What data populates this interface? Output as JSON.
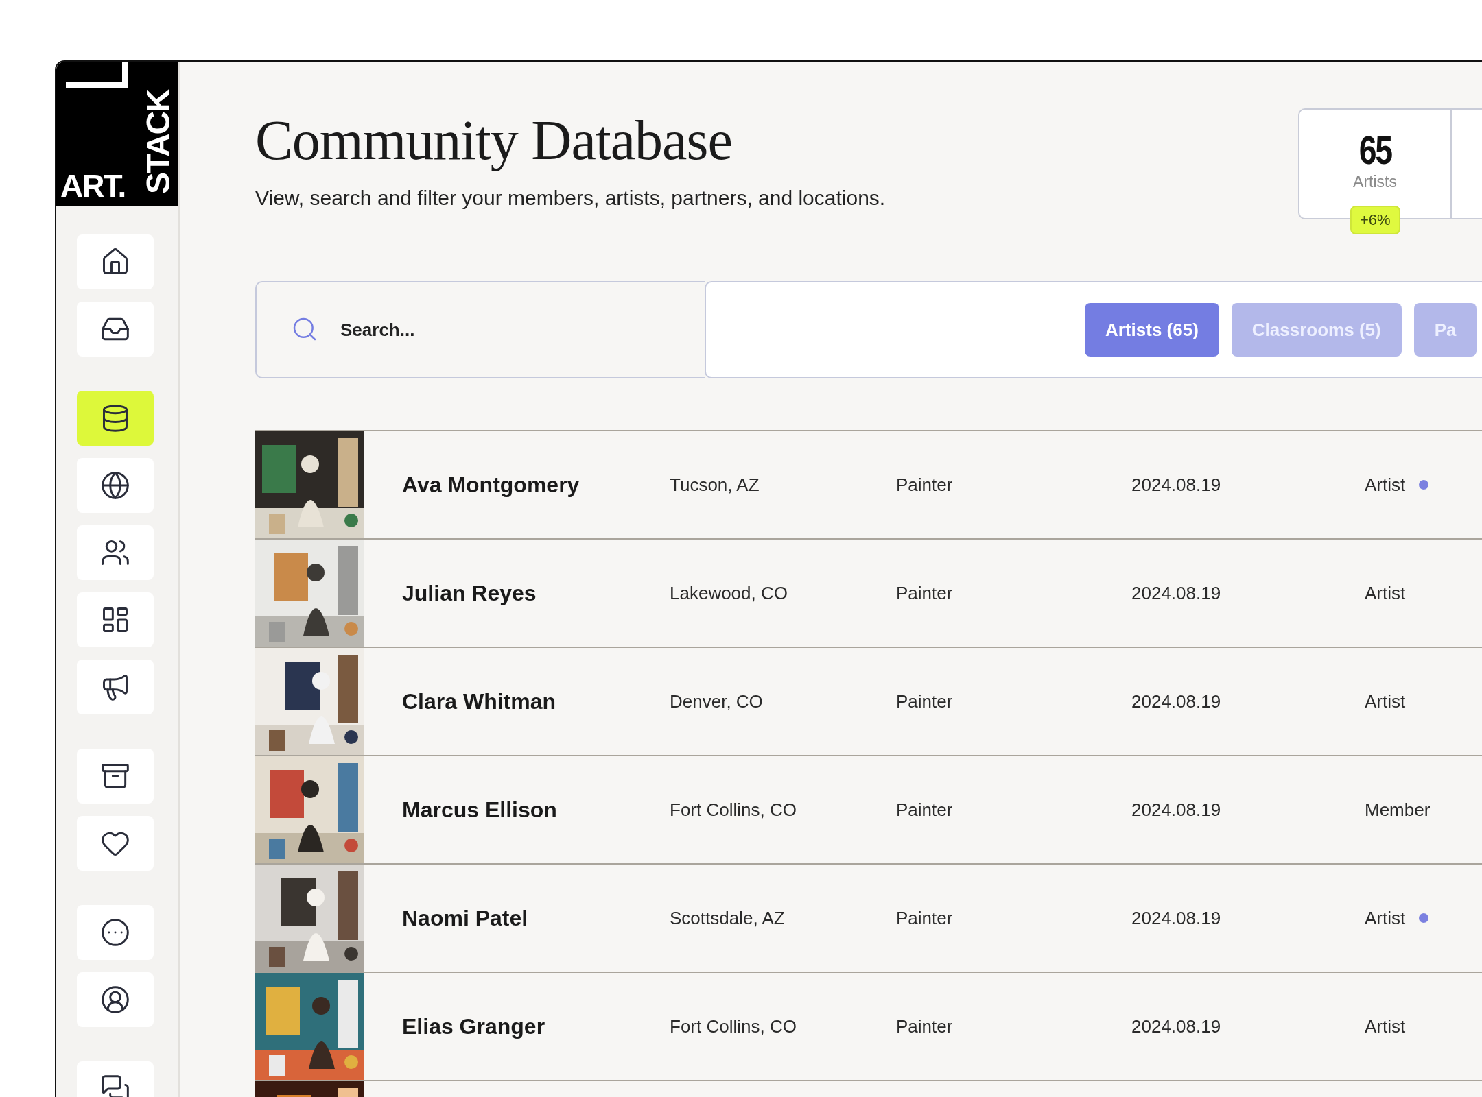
{
  "logo": {
    "line_1": "ART.",
    "line_2": "STACK"
  },
  "sidebar": {
    "groups": [
      [
        {
          "selected": false
        },
        {
          "selected": false
        }
      ],
      [
        {
          "selected": true
        },
        {
          "selected": false
        },
        {
          "selected": false
        },
        {
          "selected": false
        },
        {
          "selected": false
        }
      ],
      [
        {
          "selected": false
        },
        {
          "selected": false
        }
      ],
      [
        {
          "selected": false
        },
        {
          "selected": false
        }
      ],
      [
        {
          "selected": false
        }
      ]
    ]
  },
  "header": {
    "title": "Community Database",
    "subtitle": "View, search and filter your members, artists, partners, and locations."
  },
  "stats": [
    {
      "value": "65",
      "label": "Artists",
      "change": "+6%"
    }
  ],
  "search": {
    "placeholder": "Search..."
  },
  "tabs": [
    {
      "label": "Artists (65)",
      "selected": true
    },
    {
      "label": "Classrooms (5)",
      "selected": false
    },
    {
      "label": "Pa",
      "selected": false
    }
  ],
  "rows": [
    {
      "name": "Ava Montgomery",
      "location": "Tucson, AZ",
      "discipline": "Painter",
      "date": "2024.08.19",
      "type": "Artist",
      "color": "#7b80e0"
    },
    {
      "name": "Julian Reyes",
      "location": "Lakewood, CO",
      "discipline": "Painter",
      "date": "2024.08.19",
      "type": "Artist"
    },
    {
      "name": "Clara Whitman",
      "location": "Denver, CO",
      "discipline": "Painter",
      "date": "2024.08.19",
      "type": "Artist"
    },
    {
      "name": "Marcus Ellison",
      "location": "Fort Collins, CO",
      "discipline": "Painter",
      "date": "2024.08.19",
      "type": "Member"
    },
    {
      "name": "Naomi Patel",
      "location": "Scottsdale, AZ",
      "discipline": "Painter",
      "date": "2024.08.19",
      "type": "Artist",
      "color": "#7b80e0"
    },
    {
      "name": "Elias Granger",
      "location": "Fort Collins, CO",
      "discipline": "Painter",
      "date": "2024.08.19",
      "type": "Artist"
    }
  ]
}
